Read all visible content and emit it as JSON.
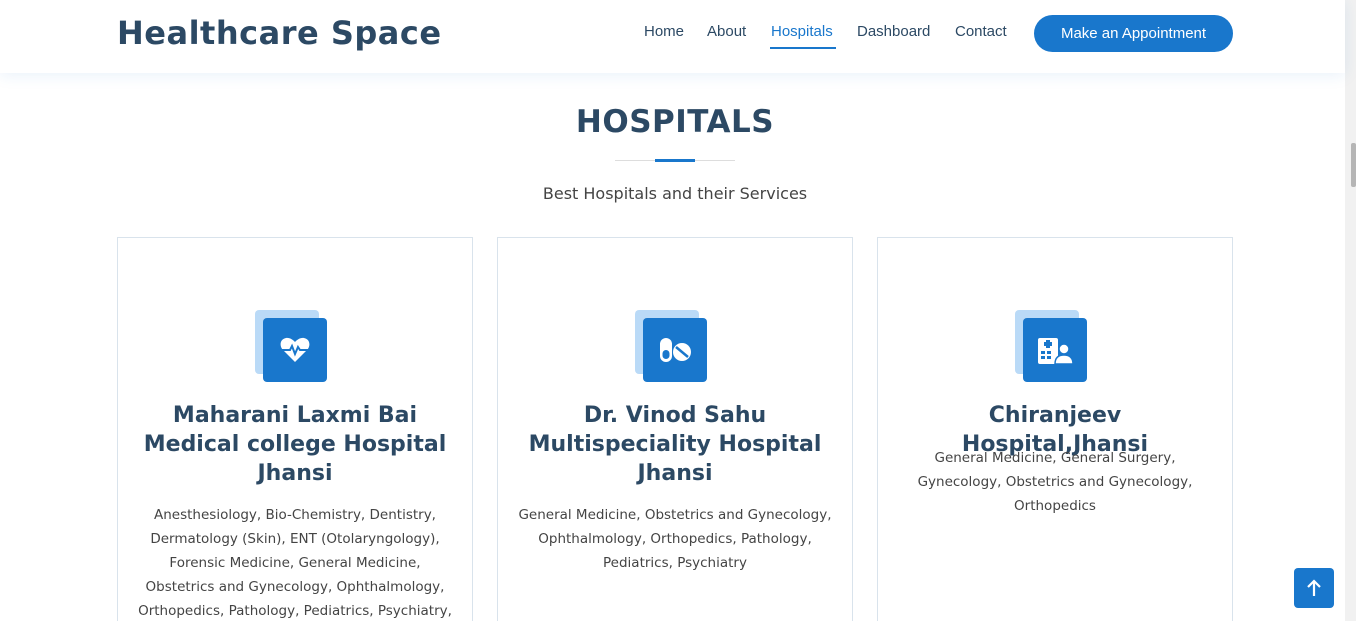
{
  "header": {
    "logo": "Healthcare Space",
    "nav": [
      "Home",
      "About",
      "Hospitals",
      "Dashboard",
      "Contact"
    ],
    "active_nav": "Hospitals",
    "cta": "Make an Appointment"
  },
  "section": {
    "title": "HOSPITALS",
    "subtitle": "Best Hospitals and their Services"
  },
  "cards": [
    {
      "icon": "heart-pulse-icon",
      "name": "Maharani Laxmi Bai Medical college Hospital Jhansi",
      "services": "Anesthesiology, Bio-Chemistry, Dentistry, Dermatology (Skin), ENT (Otolaryngology), Forensic Medicine, General Medicine, Obstetrics and Gynecology, Ophthalmology, Orthopedics, Pathology, Pediatrics, Psychiatry,"
    },
    {
      "icon": "pills-icon",
      "name": "Dr. Vinod Sahu Multispeciality Hospital Jhansi",
      "services": "General Medicine, Obstetrics and Gynecology, Ophthalmology, Orthopedics, Pathology, Pediatrics, Psychiatry"
    },
    {
      "icon": "hospital-user-icon",
      "name": "Chiranjeev Hospital,Jhansi",
      "services": "General Medicine, General Surgery, Gynecology, Obstetrics and Gynecology, Orthopedics"
    }
  ],
  "colors": {
    "accent": "#1977cc",
    "heading": "#2c4964",
    "icon_back": "#badaf7"
  }
}
